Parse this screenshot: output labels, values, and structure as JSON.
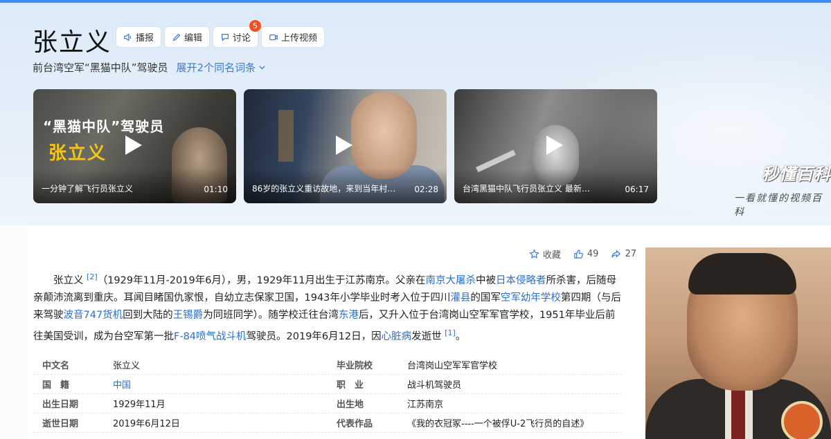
{
  "header": {
    "title": "张立义",
    "subtitle": "前台湾空军“黑猫中队”驾驶员",
    "expand_label": "展开2个同名词条",
    "actions": {
      "broadcast": "播报",
      "edit": "编辑",
      "discuss": "讨论",
      "discuss_count": "5",
      "upload": "上传视频"
    }
  },
  "videos": [
    {
      "caption": "一分钟了解飞行员张立义",
      "duration": "01:10",
      "overlay_line1": "“黑猫中队”驾驶员",
      "overlay_line2": "张立义"
    },
    {
      "caption": "86岁的张立义重访故地，来到当年村…",
      "duration": "02:28"
    },
    {
      "caption": "台湾黑猫中队飞行员张立义 最新…",
      "duration": "06:17"
    }
  ],
  "brand": {
    "logo_text": "秒懂百科",
    "slogan": "一看就懂的视频百科"
  },
  "meta": {
    "favorite": "收藏",
    "likes": "49",
    "shares": "27"
  },
  "summary": {
    "name": "张立义",
    "ref1": "[2]",
    "seg1": "（1929年11月-2019年6月），男，1929年11月出生于江苏南京。父亲在",
    "link1": "南京大屠杀",
    "seg2": "中被",
    "link2": "日本侵略者",
    "seg3": "所杀害，后随母亲颠沛流离到重庆。耳闻目睹国仇家恨，自幼立志保家卫国，1943年小学毕业时考入位于四川",
    "link3": "灌县",
    "seg4": "的国军",
    "link4": "空军幼年学校",
    "seg5": "第四期（与后来驾驶",
    "link5": "波音747货机",
    "seg6": "回到大陆的",
    "link6": "王锡爵",
    "seg7": "为同班同学）。随学校迁往台湾",
    "link7": "东港",
    "seg8": "后，又升入位于台湾岗山空军军官学校，1951年毕业后前往美国受训，成为台空军第一批",
    "link8": "F-84喷气战斗机",
    "seg9": "驾驶员。2019年6月12日，因",
    "link9": "心脏病",
    "seg10": "发逝世",
    "ref2": "[1]",
    "seg11": "。"
  },
  "info": [
    {
      "k1": "中文名",
      "v1": "张立义",
      "k2": "毕业院校",
      "v2": "台湾岗山空军军官学校"
    },
    {
      "k1": "国　籍",
      "v1": "中国",
      "k2": "职　业",
      "v2": "战斗机驾驶员"
    },
    {
      "k1": "出生日期",
      "v1": "1929年11月",
      "k2": "出生地",
      "v2": "江苏南京"
    },
    {
      "k1": "逝世日期",
      "v1": "2019年6月12日",
      "k2": "代表作品",
      "v2": "《我的衣冠冢----一个被俘U-2飞行员的自述》"
    }
  ],
  "colors": {
    "accent": "#3a7ad9",
    "badge": "#f4511e",
    "link": "#2b6fc9"
  }
}
